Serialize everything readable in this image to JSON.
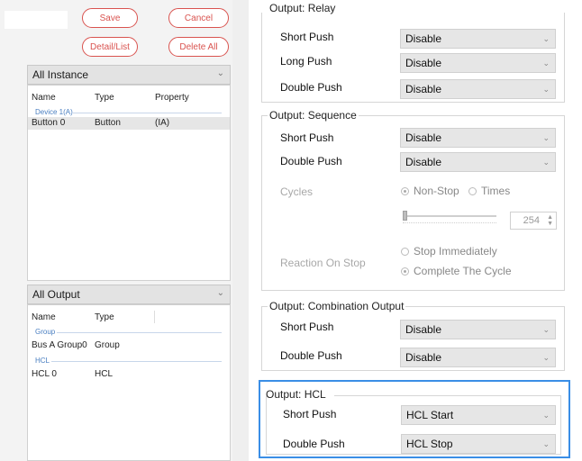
{
  "buttons": {
    "save": "Save",
    "cancel": "Cancel",
    "detail_list": "Detail/List",
    "delete_all": "Delete All"
  },
  "instance_combo": {
    "value": "All Instance",
    "icon": "chevron-down-icon"
  },
  "instance_list": {
    "headers": [
      "Name",
      "Type",
      "Property"
    ],
    "group": "Device 1(A)",
    "rows": [
      {
        "name": "Button 0",
        "type": "Button",
        "property": "(IA)"
      }
    ]
  },
  "output_combo": {
    "value": "All Output",
    "icon": "chevron-down-icon"
  },
  "output_list": {
    "headers": [
      "Name",
      "Type"
    ],
    "groups": [
      {
        "label": "Group",
        "rows": [
          {
            "name": "Bus A Group0",
            "type": "Group"
          }
        ]
      },
      {
        "label": "HCL",
        "rows": [
          {
            "name": "HCL 0",
            "type": "HCL"
          }
        ]
      }
    ]
  },
  "relay": {
    "title": "Output: Relay",
    "short_push": {
      "label": "Short Push",
      "value": "Disable"
    },
    "long_push": {
      "label": "Long Push",
      "value": "Disable"
    },
    "double_push": {
      "label": "Double Push",
      "value": "Disable"
    }
  },
  "sequence": {
    "title": "Output: Sequence",
    "short_push": {
      "label": "Short Push",
      "value": "Disable"
    },
    "double_push": {
      "label": "Double Push",
      "value": "Disable"
    },
    "cycles": {
      "label": "Cycles",
      "option_nonstop": "Non-Stop",
      "option_times": "Times",
      "selected": "Non-Stop"
    },
    "times_value": "254",
    "slider_fraction": 0.0,
    "reaction": {
      "label": "Reaction On Stop",
      "option_stop": "Stop Immediately",
      "option_complete": "Complete The Cycle",
      "selected": "Complete The Cycle"
    }
  },
  "combination": {
    "title": "Output: Combination Output",
    "short_push": {
      "label": "Short Push",
      "value": "Disable"
    },
    "double_push": {
      "label": "Double Push",
      "value": "Disable"
    }
  },
  "hcl": {
    "title": "Output: HCL",
    "short_push": {
      "label": "Short Push",
      "value": "HCL Start"
    },
    "double_push": {
      "label": "Double Push",
      "value": "HCL Stop"
    }
  },
  "colors": {
    "accent_red": "#d9534f",
    "highlight_blue": "#3a8ee6",
    "group_blue": "#4a7fc1"
  }
}
